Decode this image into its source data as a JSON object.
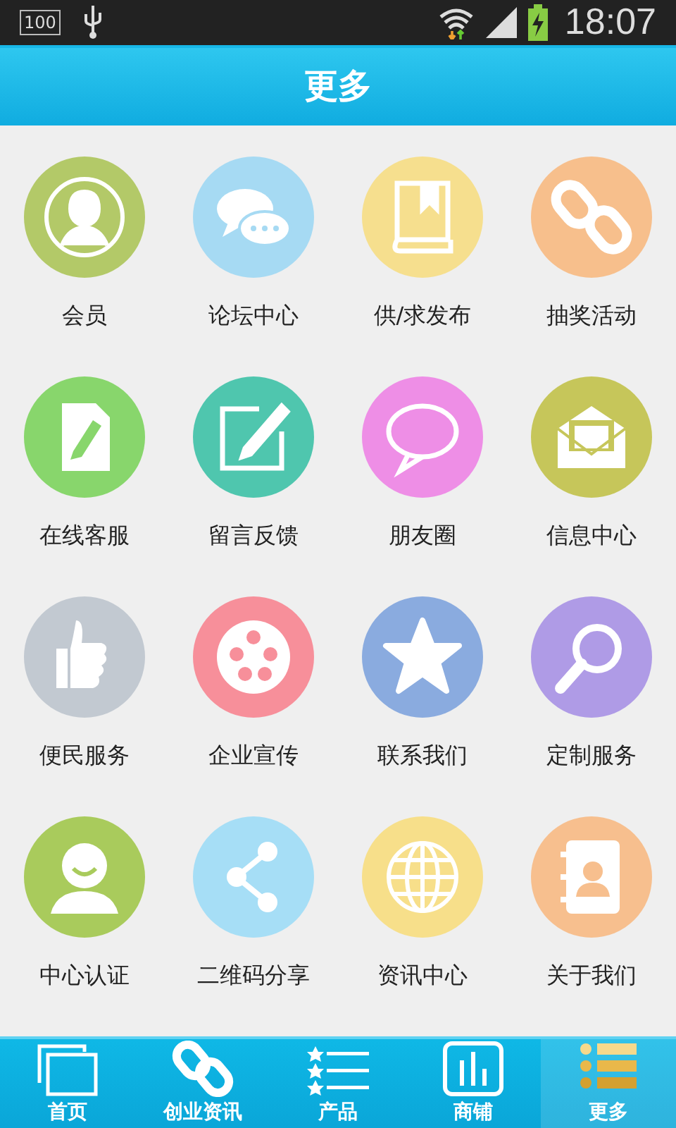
{
  "status_bar": {
    "battery_badge": "100",
    "time": "18:07"
  },
  "header": {
    "title": "更多"
  },
  "items": [
    {
      "label": "会员",
      "color": "#b3c968"
    },
    {
      "label": "论坛中心",
      "color": "#a6daf3"
    },
    {
      "label": "供/求发布",
      "color": "#f6df8e"
    },
    {
      "label": "抽奖活动",
      "color": "#f7bf8c"
    },
    {
      "label": "在线客服",
      "color": "#88d66c"
    },
    {
      "label": "留言反馈",
      "color": "#4fc6ae"
    },
    {
      "label": "朋友圈",
      "color": "#ee8ee6"
    },
    {
      "label": "信息中心",
      "color": "#c6c65a"
    },
    {
      "label": "便民服务",
      "color": "#c2c9d1"
    },
    {
      "label": "企业宣传",
      "color": "#f78f9a"
    },
    {
      "label": "联系我们",
      "color": "#8aabdf"
    },
    {
      "label": "定制服务",
      "color": "#af9be6"
    },
    {
      "label": "中心认证",
      "color": "#a9cb5c"
    },
    {
      "label": "二维码分享",
      "color": "#a6def6"
    },
    {
      "label": "资讯中心",
      "color": "#f7df8a"
    },
    {
      "label": "关于我们",
      "color": "#f7bf8e"
    }
  ],
  "tabs": [
    {
      "label": "首页",
      "selected": false
    },
    {
      "label": "创业资讯",
      "selected": false
    },
    {
      "label": "产品",
      "selected": false
    },
    {
      "label": "商铺",
      "selected": false
    },
    {
      "label": "更多",
      "selected": true
    }
  ]
}
